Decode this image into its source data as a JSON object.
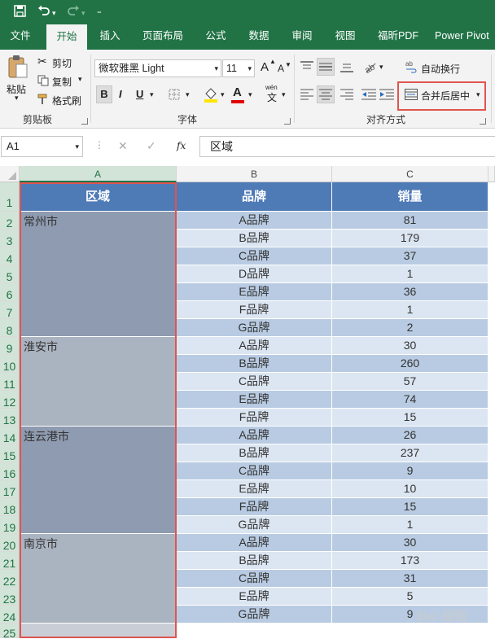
{
  "title_bar": {
    "save_icon": "save-icon",
    "undo_icon": "undo-icon",
    "redo_icon": "redo-icon",
    "customize_icon": "customize-icon"
  },
  "tabs": [
    "文件",
    "开始",
    "插入",
    "页面布局",
    "公式",
    "数据",
    "审阅",
    "视图",
    "福昕PDF",
    "Power Pivot"
  ],
  "active_tab": "开始",
  "ribbon": {
    "clipboard": {
      "paste": "粘贴",
      "cut": "剪切",
      "copy": "复制",
      "format_painter": "格式刷",
      "label": "剪贴板"
    },
    "font": {
      "font_name": "微软雅黑 Light",
      "font_size": "11",
      "bold": "B",
      "italic": "I",
      "underline": "U",
      "font_color_letter": "A",
      "wen": "wén",
      "wen_char": "文",
      "grow": "A",
      "shrink": "A",
      "label": "字体"
    },
    "alignment": {
      "wrap_text": "自动换行",
      "merge_center": "合并后居中",
      "label": "对齐方式"
    }
  },
  "formula_bar": {
    "name_box": "A1",
    "cancel": "✕",
    "enter": "✓",
    "fx": "fx",
    "content": "区域"
  },
  "columns": [
    "A",
    "B",
    "C"
  ],
  "rows": [
    "1",
    "2",
    "3",
    "4",
    "5",
    "6",
    "7",
    "8",
    "9",
    "10",
    "11",
    "12",
    "13",
    "14",
    "15",
    "16",
    "17",
    "18",
    "19",
    "20",
    "21",
    "22",
    "23",
    "24",
    "25"
  ],
  "header": {
    "region": "区域",
    "brand": "品牌",
    "sales": "销量"
  },
  "regions": [
    "常州市",
    "淮安市",
    "连云港市",
    "南京市"
  ],
  "data_rows": [
    {
      "brand": "A品牌",
      "sales": "81"
    },
    {
      "brand": "B品牌",
      "sales": "179"
    },
    {
      "brand": "C品牌",
      "sales": "37"
    },
    {
      "brand": "D品牌",
      "sales": "1"
    },
    {
      "brand": "E品牌",
      "sales": "36"
    },
    {
      "brand": "F品牌",
      "sales": "1"
    },
    {
      "brand": "G品牌",
      "sales": "2"
    },
    {
      "brand": "A品牌",
      "sales": "30"
    },
    {
      "brand": "B品牌",
      "sales": "260"
    },
    {
      "brand": "C品牌",
      "sales": "57"
    },
    {
      "brand": "E品牌",
      "sales": "74"
    },
    {
      "brand": "F品牌",
      "sales": "15"
    },
    {
      "brand": "A品牌",
      "sales": "26"
    },
    {
      "brand": "B品牌",
      "sales": "237"
    },
    {
      "brand": "C品牌",
      "sales": "9"
    },
    {
      "brand": "E品牌",
      "sales": "10"
    },
    {
      "brand": "F品牌",
      "sales": "15"
    },
    {
      "brand": "G品牌",
      "sales": "1"
    },
    {
      "brand": "A品牌",
      "sales": "30"
    },
    {
      "brand": "B品牌",
      "sales": "173"
    },
    {
      "brand": "C品牌",
      "sales": "31"
    },
    {
      "brand": "E品牌",
      "sales": "5"
    },
    {
      "brand": "G品牌",
      "sales": "9"
    }
  ],
  "watermark": "Bai 经验",
  "colors": {
    "excel_green": "#217346",
    "header_blue": "#4e7ab6",
    "highlight_red": "#e0544f"
  }
}
